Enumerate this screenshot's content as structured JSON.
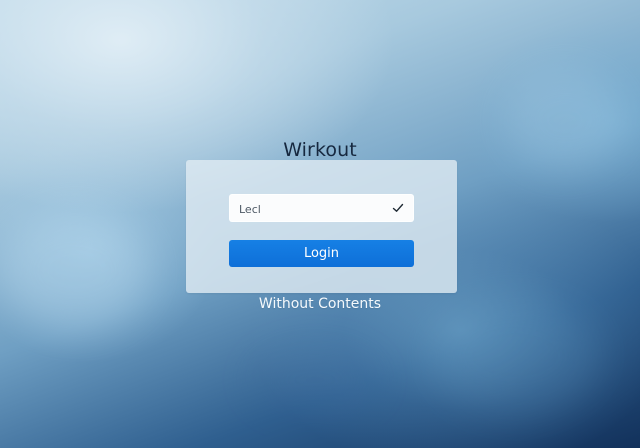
{
  "app": {
    "title": "Wirkout",
    "subtitle": "Without Contents"
  },
  "login": {
    "input_value": "Lecl",
    "button_label": "Login"
  },
  "icons": {
    "checkmark": "checkmark-icon"
  },
  "colors": {
    "accent": "#0e6fd8",
    "card_background": "#e0ebf3",
    "title_text": "#16283f",
    "subtitle_text": "#f5f9fc"
  }
}
